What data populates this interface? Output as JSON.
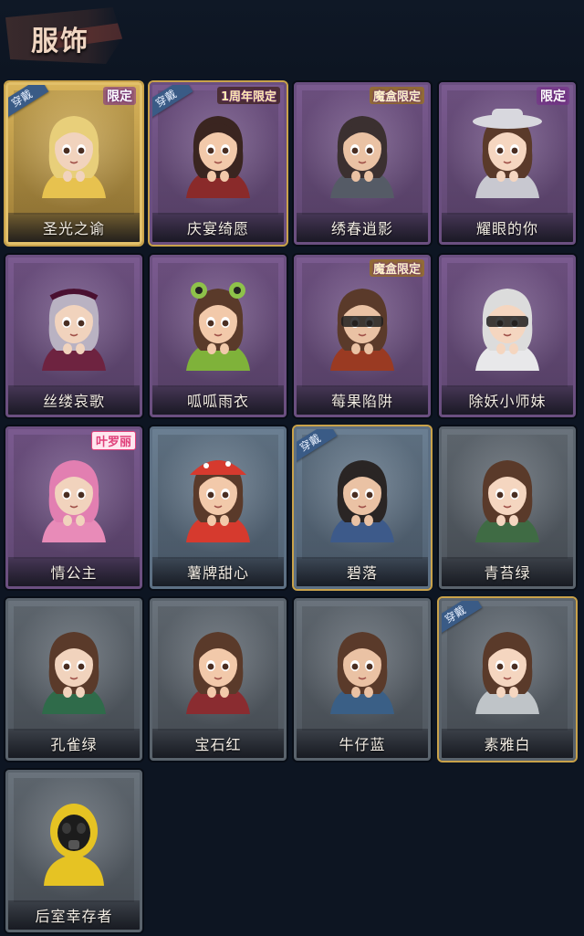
{
  "header": {
    "title": "服饰"
  },
  "cards": [
    {
      "name": "圣光之谕",
      "rarity": "gold",
      "tag": "限定",
      "tag_style": "limited",
      "equipped": true,
      "equip_label": "穿戴",
      "avatar": "blonde-veil"
    },
    {
      "name": "庆宴绮愿",
      "rarity": "purple",
      "tag": "1周年限定",
      "tag_style": "anniv",
      "equipped": true,
      "equip_label": "穿戴",
      "avatar": "cake-party"
    },
    {
      "name": "绣春逍影",
      "rarity": "purple",
      "tag": "魔盒限定",
      "tag_style": "box",
      "equipped": false,
      "equip_label": "",
      "avatar": "headband"
    },
    {
      "name": "耀眼的你",
      "rarity": "purple",
      "tag": "限定",
      "tag_style": "limited",
      "equipped": false,
      "equip_label": "",
      "avatar": "cowboy-hat"
    },
    {
      "name": "丝缕哀歌",
      "rarity": "purple",
      "tag": "",
      "tag_style": "",
      "equipped": false,
      "equip_label": "",
      "avatar": "lace-crown"
    },
    {
      "name": "呱呱雨衣",
      "rarity": "purple",
      "tag": "",
      "tag_style": "",
      "equipped": false,
      "equip_label": "",
      "avatar": "frog-hood"
    },
    {
      "name": "莓果陷阱",
      "rarity": "purple",
      "tag": "魔盒限定",
      "tag_style": "box",
      "equipped": false,
      "equip_label": "",
      "avatar": "berry-blindfold"
    },
    {
      "name": "除妖小师妹",
      "rarity": "purple",
      "tag": "",
      "tag_style": "",
      "equipped": false,
      "equip_label": "",
      "avatar": "white-blindfold"
    },
    {
      "name": "情公主",
      "rarity": "purple",
      "tag": "叶罗丽",
      "tag_style": "pink",
      "equipped": false,
      "equip_label": "",
      "avatar": "pink-hair"
    },
    {
      "name": "薯牌甜心",
      "rarity": "blue",
      "tag": "",
      "tag_style": "",
      "equipped": false,
      "equip_label": "",
      "avatar": "mushroom-hat"
    },
    {
      "name": "碧落",
      "rarity": "blue",
      "tag": "",
      "tag_style": "",
      "equipped": true,
      "equip_label": "穿戴",
      "avatar": "boy-braid"
    },
    {
      "name": "青苔绿",
      "rarity": "grey",
      "tag": "",
      "tag_style": "",
      "equipped": false,
      "equip_label": "",
      "avatar": "default-green"
    },
    {
      "name": "孔雀绿",
      "rarity": "grey",
      "tag": "",
      "tag_style": "",
      "equipped": false,
      "equip_label": "",
      "avatar": "default-teal"
    },
    {
      "name": "宝石红",
      "rarity": "grey",
      "tag": "",
      "tag_style": "",
      "equipped": false,
      "equip_label": "",
      "avatar": "default-red"
    },
    {
      "name": "牛仔蓝",
      "rarity": "grey",
      "tag": "",
      "tag_style": "",
      "equipped": false,
      "equip_label": "",
      "avatar": "default-blue"
    },
    {
      "name": "素雅白",
      "rarity": "grey",
      "tag": "",
      "tag_style": "",
      "equipped": true,
      "equip_label": "穿戴",
      "avatar": "default-white"
    },
    {
      "name": "后室幸存者",
      "rarity": "grey",
      "tag": "",
      "tag_style": "",
      "equipped": false,
      "equip_label": "",
      "avatar": "hazmat"
    }
  ],
  "colors": {
    "background": "#0d1522",
    "equip_badge": "#3a5b86",
    "gold": "#e2c06a",
    "purple": "#6b4f80"
  }
}
